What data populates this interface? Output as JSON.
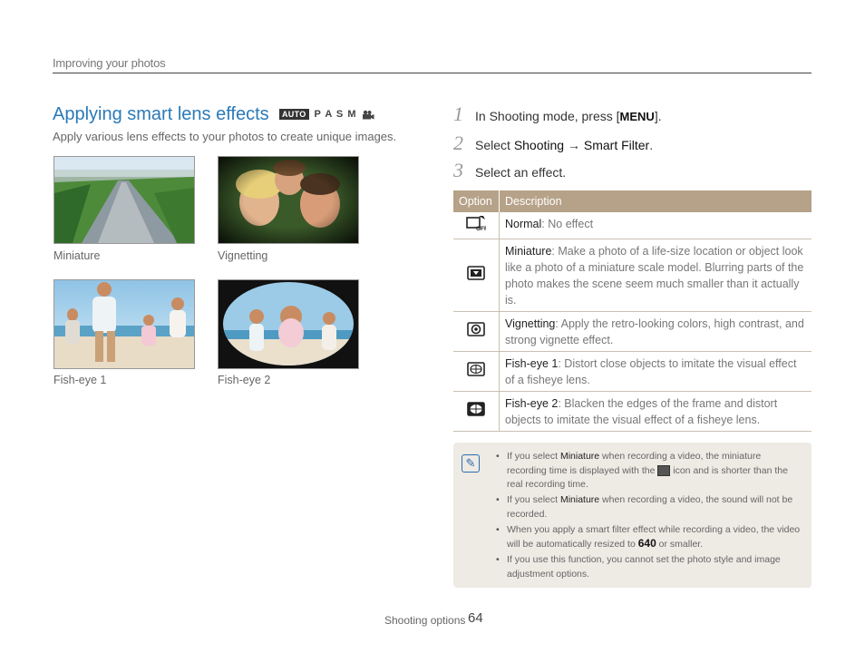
{
  "header": {
    "section": "Improving your photos"
  },
  "title": "Applying smart lens effects",
  "modes": {
    "auto": "AUTO",
    "letters": "P A S M",
    "movie_icon": "movie-camera-icon"
  },
  "subtitle": "Apply various lens effects to your photos to create unique images.",
  "photos": [
    {
      "caption": "Miniature"
    },
    {
      "caption": "Vignetting"
    },
    {
      "caption": "Fish-eye 1"
    },
    {
      "caption": "Fish-eye 2"
    }
  ],
  "steps": [
    {
      "num": "1",
      "pre": "In Shooting mode, press [",
      "key": "MENU",
      "post": "]."
    },
    {
      "num": "2",
      "pre": "Select ",
      "bold1": "Shooting",
      "arrow": " → ",
      "bold2": "Smart Filter",
      "post": "."
    },
    {
      "num": "3",
      "text": "Select an effect."
    }
  ],
  "table": {
    "headers": [
      "Option",
      "Description"
    ],
    "rows": [
      {
        "icon": "normal-off-icon",
        "name": "Normal",
        "desc": ": No effect"
      },
      {
        "icon": "miniature-icon",
        "name": "Miniature",
        "desc": ": Make a photo of a life-size location or object look like a photo of a miniature scale model. Blurring parts of the photo makes the scene seem much smaller than it actually is."
      },
      {
        "icon": "vignetting-icon",
        "name": "Vignetting",
        "desc": ": Apply the retro-looking colors, high contrast, and strong vignette effect."
      },
      {
        "icon": "fisheye1-icon",
        "name": "Fish-eye 1",
        "desc": ": Distort close objects to imitate the visual effect of a fisheye lens."
      },
      {
        "icon": "fisheye2-icon",
        "name": "Fish-eye 2",
        "desc": ": Blacken the edges of the frame and distort objects to imitate the visual effect of a fisheye lens."
      }
    ]
  },
  "notes": [
    {
      "pre": "If you select ",
      "bold": "Miniature",
      "post": " when recording a video, the miniature recording time is displayed with the ",
      "icon": "miniature-icon",
      "post2": " icon and is shorter than the real recording time."
    },
    {
      "pre": "If you select ",
      "bold": "Miniature",
      "post": " when recording a video, the sound will not be recorded."
    },
    {
      "pre": "When you apply a smart filter effect while recording a video, the video will be automatically resized to ",
      "res": "640",
      "post": " or smaller."
    },
    {
      "pre": "If you use this function, you cannot set the photo style and image adjustment options."
    }
  ],
  "footer": {
    "label": "Shooting options",
    "page": "64"
  },
  "colors": {
    "title_blue": "#2a7ab8",
    "table_header": "#b6a288",
    "note_bg": "#eeeae4"
  }
}
